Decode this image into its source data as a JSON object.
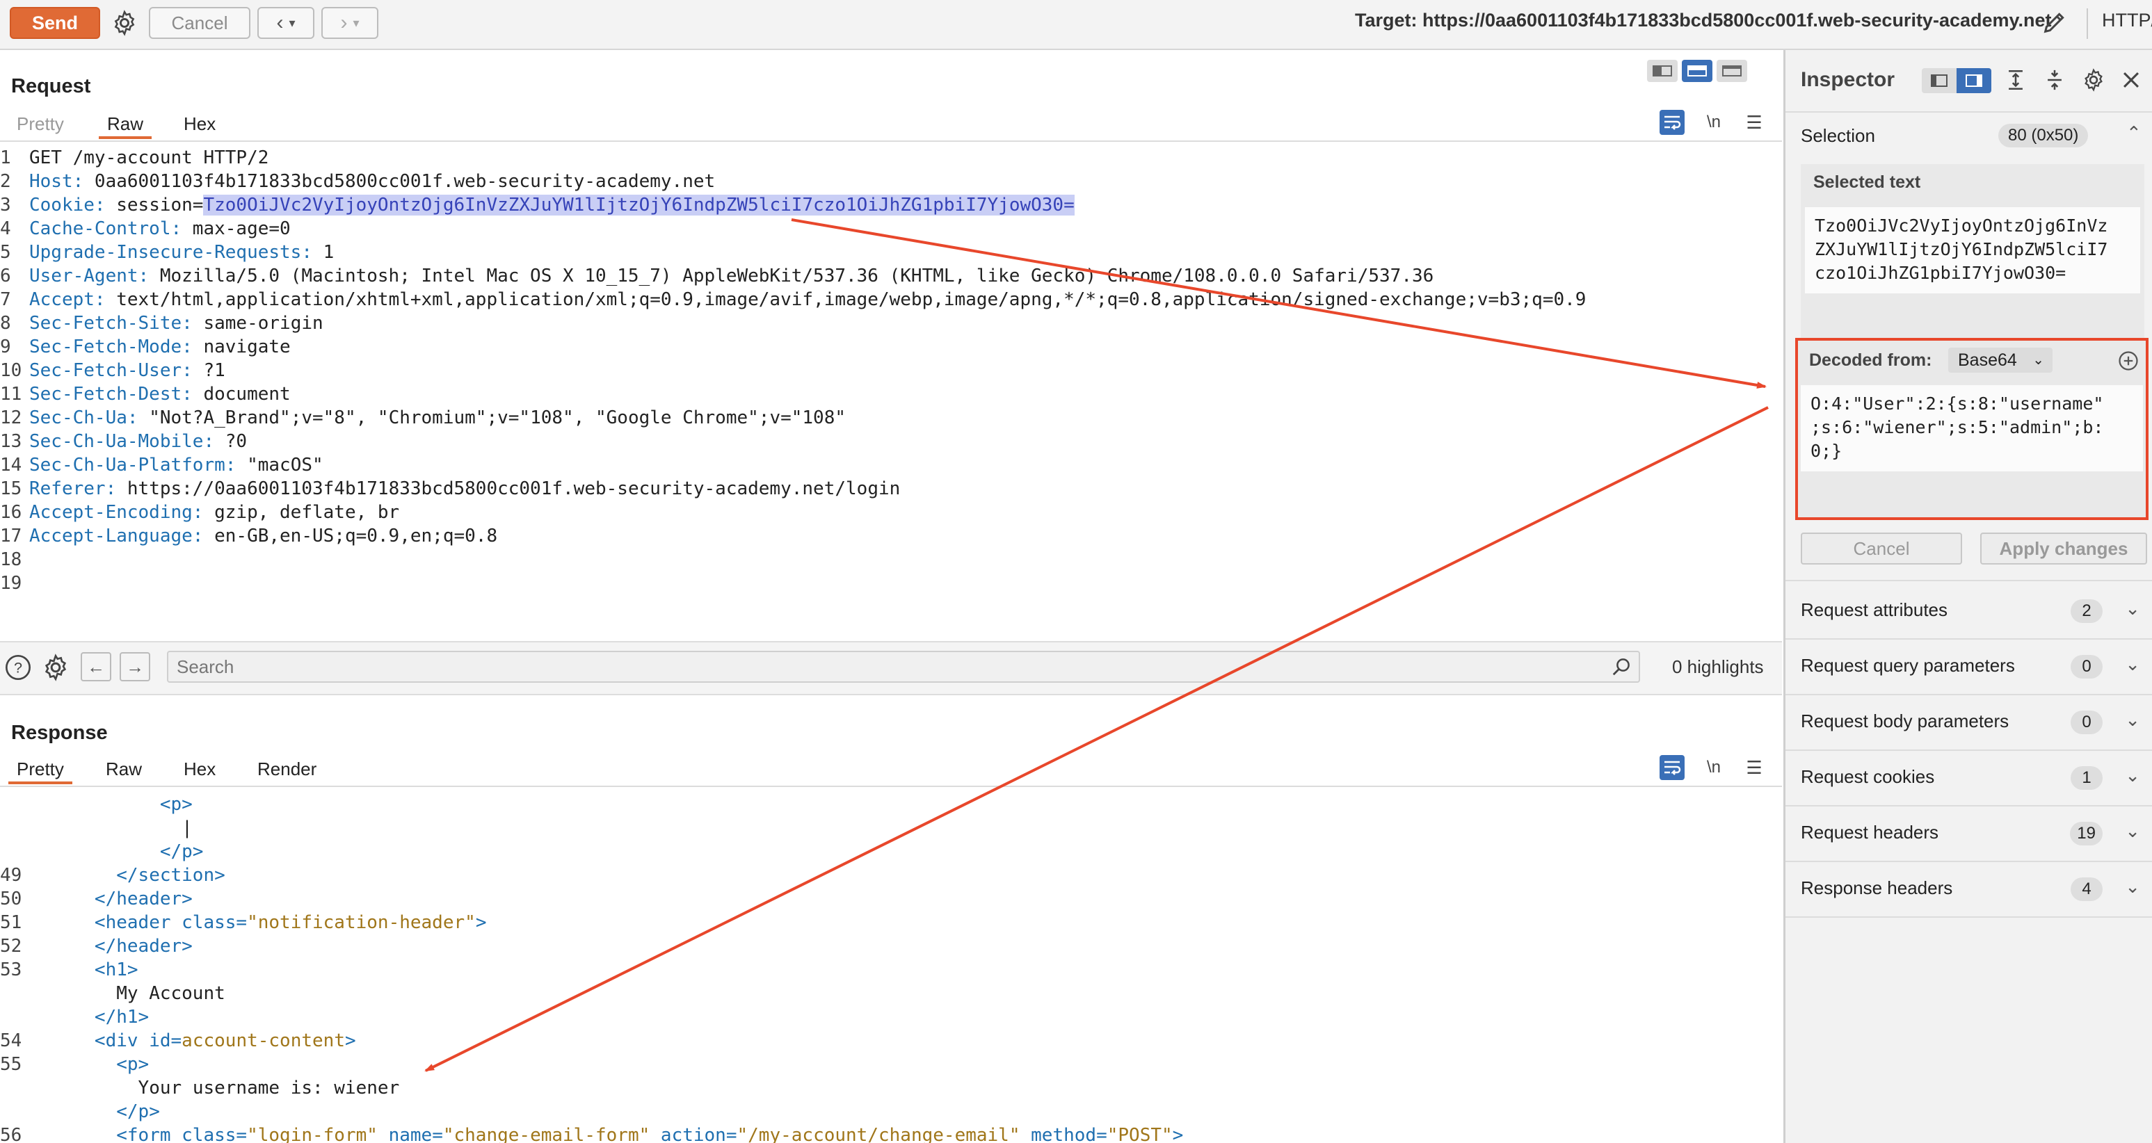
{
  "toolbar": {
    "send_label": "Send",
    "cancel_label": "Cancel",
    "target": "Target: https://0aa6001103f4b171833bcd5800cc001f.web-security-academy.net",
    "protocol": "HTTP/"
  },
  "request": {
    "title": "Request",
    "tabs": [
      "Pretty",
      "Raw",
      "Hex"
    ],
    "active_tab": "Raw",
    "newline_label": "\\n",
    "lines": [
      {
        "n": "1",
        "name": "GET /my-account HTTP/2",
        "value": ""
      },
      {
        "n": "2",
        "name": "Host:",
        "value": " 0aa6001103f4b171833bcd5800cc001f.web-security-academy.net"
      },
      {
        "n": "3",
        "name": "Cookie:",
        "value": " session="
      },
      {
        "n": "4",
        "name": "Cache-Control:",
        "value": " max-age=0"
      },
      {
        "n": "5",
        "name": "Upgrade-Insecure-Requests:",
        "value": " 1"
      },
      {
        "n": "6",
        "name": "User-Agent:",
        "value": " Mozilla/5.0 (Macintosh; Intel Mac OS X 10_15_7) AppleWebKit/537.36 (KHTML, like Gecko) Chrome/108.0.0.0 Safari/537.36"
      },
      {
        "n": "7",
        "name": "Accept:",
        "value": " text/html,application/xhtml+xml,application/xml;q=0.9,image/avif,image/webp,image/apng,*/*;q=0.8,application/signed-exchange;v=b3;q=0.9"
      },
      {
        "n": "8",
        "name": "Sec-Fetch-Site:",
        "value": " same-origin"
      },
      {
        "n": "9",
        "name": "Sec-Fetch-Mode:",
        "value": " navigate"
      },
      {
        "n": "10",
        "name": "Sec-Fetch-User:",
        "value": " ?1"
      },
      {
        "n": "11",
        "name": "Sec-Fetch-Dest:",
        "value": " document"
      },
      {
        "n": "12",
        "name": "Sec-Ch-Ua:",
        "value": " \"Not?A_Brand\";v=\"8\", \"Chromium\";v=\"108\", \"Google Chrome\";v=\"108\""
      },
      {
        "n": "13",
        "name": "Sec-Ch-Ua-Mobile:",
        "value": " ?0"
      },
      {
        "n": "14",
        "name": "Sec-Ch-Ua-Platform:",
        "value": " \"macOS\""
      },
      {
        "n": "15",
        "name": "Referer:",
        "value": " https://0aa6001103f4b171833bcd5800cc001f.web-security-academy.net/login"
      },
      {
        "n": "16",
        "name": "Accept-Encoding:",
        "value": " gzip, deflate, br"
      },
      {
        "n": "17",
        "name": "Accept-Language:",
        "value": " en-GB,en-US;q=0.9,en;q=0.8"
      },
      {
        "n": "18",
        "name": "",
        "value": ""
      },
      {
        "n": "19",
        "name": "",
        "value": ""
      }
    ],
    "session_value": "Tzo0OiJVc2VyIjoyOntzOjg6InVzZXJuYW1lIjtzOjY6IndpZW5lciI7czo1OiJhZG1pbiI7YjowO30="
  },
  "search": {
    "placeholder": "Search",
    "highlights": "0 highlights"
  },
  "response": {
    "title": "Response",
    "tabs": [
      "Pretty",
      "Raw",
      "Hex",
      "Render"
    ],
    "active_tab": "Pretty",
    "newline_label": "\\n",
    "lines": [
      {
        "n": "",
        "indent": 6,
        "parts": [
          [
            "t",
            "<p>"
          ]
        ]
      },
      {
        "n": "",
        "indent": 7,
        "parts": [
          [
            "x",
            "|"
          ]
        ]
      },
      {
        "n": "",
        "indent": 6,
        "parts": [
          [
            "t",
            "</p>"
          ]
        ]
      },
      {
        "n": "49",
        "indent": 4,
        "parts": [
          [
            "t",
            "</section>"
          ]
        ]
      },
      {
        "n": "50",
        "indent": 3,
        "parts": [
          [
            "t",
            "</header>"
          ]
        ]
      },
      {
        "n": "51",
        "indent": 3,
        "parts": [
          [
            "t",
            "<header "
          ],
          [
            "a",
            "class="
          ],
          [
            "v",
            "\"notification-header\""
          ],
          [
            "t",
            ">"
          ]
        ]
      },
      {
        "n": "52",
        "indent": 3,
        "parts": [
          [
            "t",
            "</header>"
          ]
        ]
      },
      {
        "n": "53",
        "indent": 3,
        "parts": [
          [
            "t",
            "<h1>"
          ]
        ]
      },
      {
        "n": "",
        "indent": 4,
        "parts": [
          [
            "x",
            "My Account"
          ]
        ]
      },
      {
        "n": "",
        "indent": 3,
        "parts": [
          [
            "t",
            "</h1>"
          ]
        ]
      },
      {
        "n": "54",
        "indent": 3,
        "parts": [
          [
            "t",
            "<div "
          ],
          [
            "a",
            "id="
          ],
          [
            "v",
            "account-content"
          ],
          [
            "t",
            ">"
          ]
        ]
      },
      {
        "n": "55",
        "indent": 4,
        "parts": [
          [
            "t",
            "<p>"
          ]
        ]
      },
      {
        "n": "",
        "indent": 5,
        "parts": [
          [
            "x",
            "Your username is: wiener"
          ]
        ]
      },
      {
        "n": "",
        "indent": 4,
        "parts": [
          [
            "t",
            "</p>"
          ]
        ]
      },
      {
        "n": "56",
        "indent": 4,
        "parts": [
          [
            "t",
            "<form "
          ],
          [
            "a",
            "class="
          ],
          [
            "v",
            "\"login-form\""
          ],
          [
            "a",
            " name="
          ],
          [
            "v",
            "\"change-email-form\""
          ],
          [
            "a",
            " action="
          ],
          [
            "v",
            "\"/my-account/change-email\""
          ],
          [
            "a",
            " method="
          ],
          [
            "v",
            "\"POST\""
          ],
          [
            "t",
            ">"
          ]
        ]
      }
    ]
  },
  "inspector": {
    "title": "Inspector",
    "selection_label": "Selection",
    "selection_badge": "80 (0x50)",
    "selected_text_label": "Selected text",
    "selected_text": "Tzo0OiJVc2VyIjoyOntzOjg6InVz\nZXJuYW1lIjtzOjY6IndpZW5lciI7\nczo1OiJhZG1pbiI7YjowO30=",
    "decoded_from_label": "Decoded from:",
    "decoded_encoding": "Base64",
    "decoded_text": "O:4:\"User\":2:{s:8:\"username\"\n;s:6:\"wiener\";s:5:\"admin\";b:\n0;}",
    "cancel_label": "Cancel",
    "apply_label": "Apply changes",
    "sections": [
      {
        "label": "Request attributes",
        "count": "2"
      },
      {
        "label": "Request query parameters",
        "count": "0"
      },
      {
        "label": "Request body parameters",
        "count": "0"
      },
      {
        "label": "Request cookies",
        "count": "1"
      },
      {
        "label": "Request headers",
        "count": "19"
      },
      {
        "label": "Response headers",
        "count": "4"
      }
    ]
  },
  "colors": {
    "accent": "#e06a35",
    "annotation": "#e8472b",
    "highlight_bg": "#c9cef5",
    "header_name": "#1f6fb0"
  },
  "icons": [
    "settings-icon",
    "back-icon",
    "forward-icon",
    "edit-icon",
    "wrap-icon",
    "menu-icon",
    "help-icon",
    "search-icon",
    "close-icon",
    "add-icon"
  ]
}
